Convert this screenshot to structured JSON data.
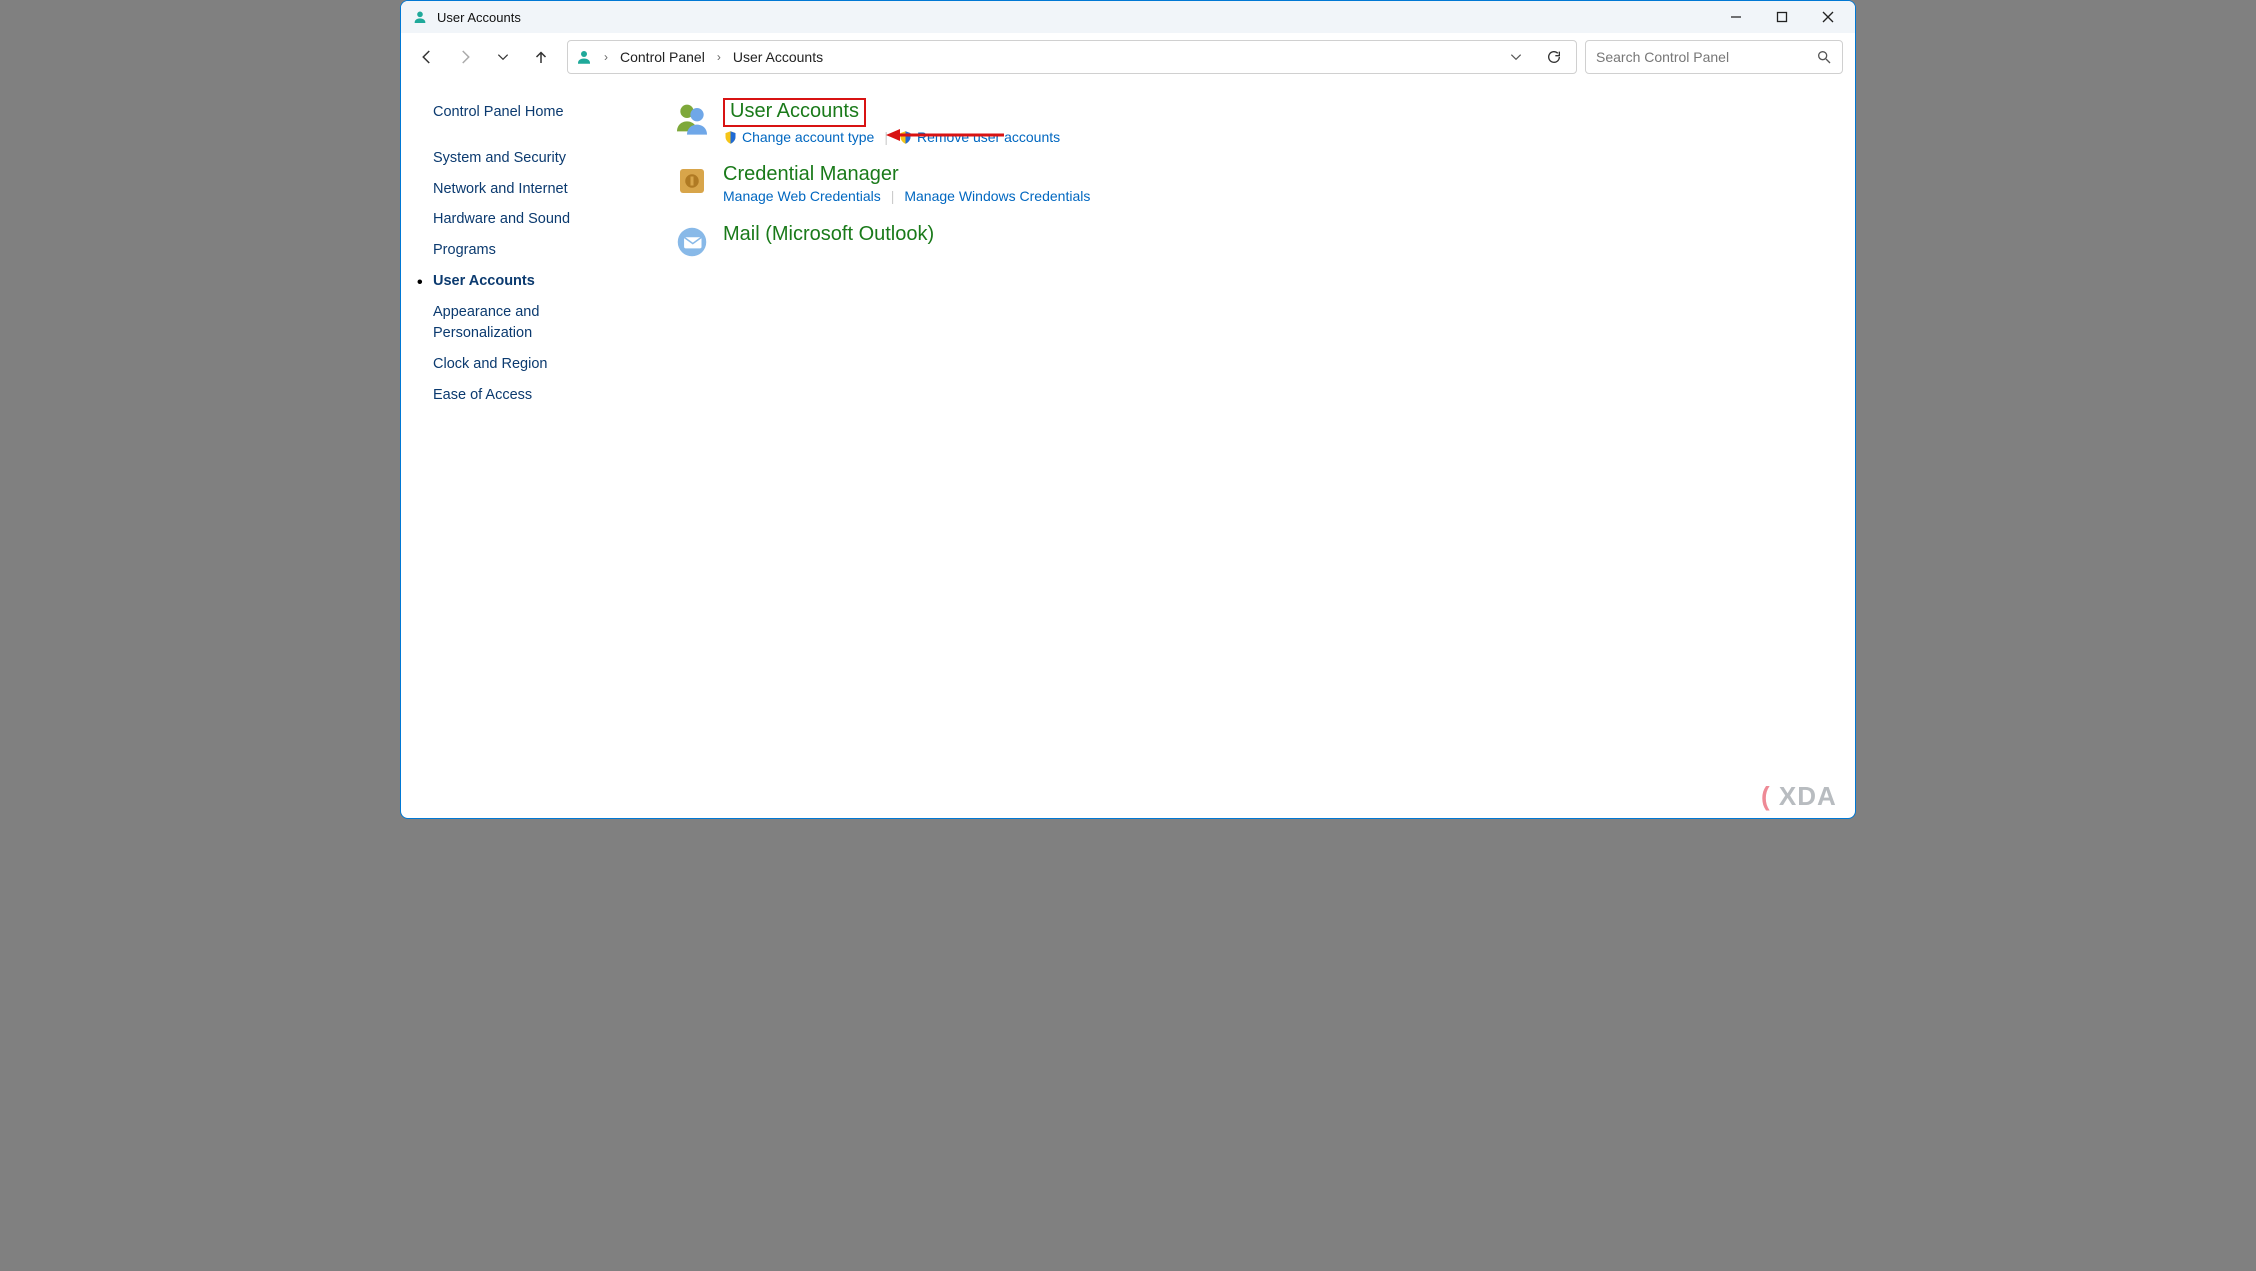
{
  "window": {
    "title": "User Accounts"
  },
  "breadcrumb": {
    "root": "Control Panel",
    "current": "User Accounts"
  },
  "search": {
    "placeholder": "Search Control Panel"
  },
  "sidebar": {
    "home": "Control Panel Home",
    "items": [
      {
        "label": "System and Security",
        "active": false
      },
      {
        "label": "Network and Internet",
        "active": false
      },
      {
        "label": "Hardware and Sound",
        "active": false
      },
      {
        "label": "Programs",
        "active": false
      },
      {
        "label": "User Accounts",
        "active": true
      },
      {
        "label": "Appearance and Personalization",
        "active": false
      },
      {
        "label": "Clock and Region",
        "active": false
      },
      {
        "label": "Ease of Access",
        "active": false
      }
    ]
  },
  "categories": [
    {
      "title": "User Accounts",
      "highlight": true,
      "tasks": [
        {
          "label": "Change account type",
          "shield": true
        },
        {
          "label": "Remove user accounts",
          "shield": true
        }
      ]
    },
    {
      "title": "Credential Manager",
      "highlight": false,
      "tasks": [
        {
          "label": "Manage Web Credentials",
          "shield": false
        },
        {
          "label": "Manage Windows Credentials",
          "shield": false
        }
      ]
    },
    {
      "title": "Mail (Microsoft Outlook)",
      "highlight": false,
      "tasks": []
    }
  ],
  "watermark": "XDA"
}
